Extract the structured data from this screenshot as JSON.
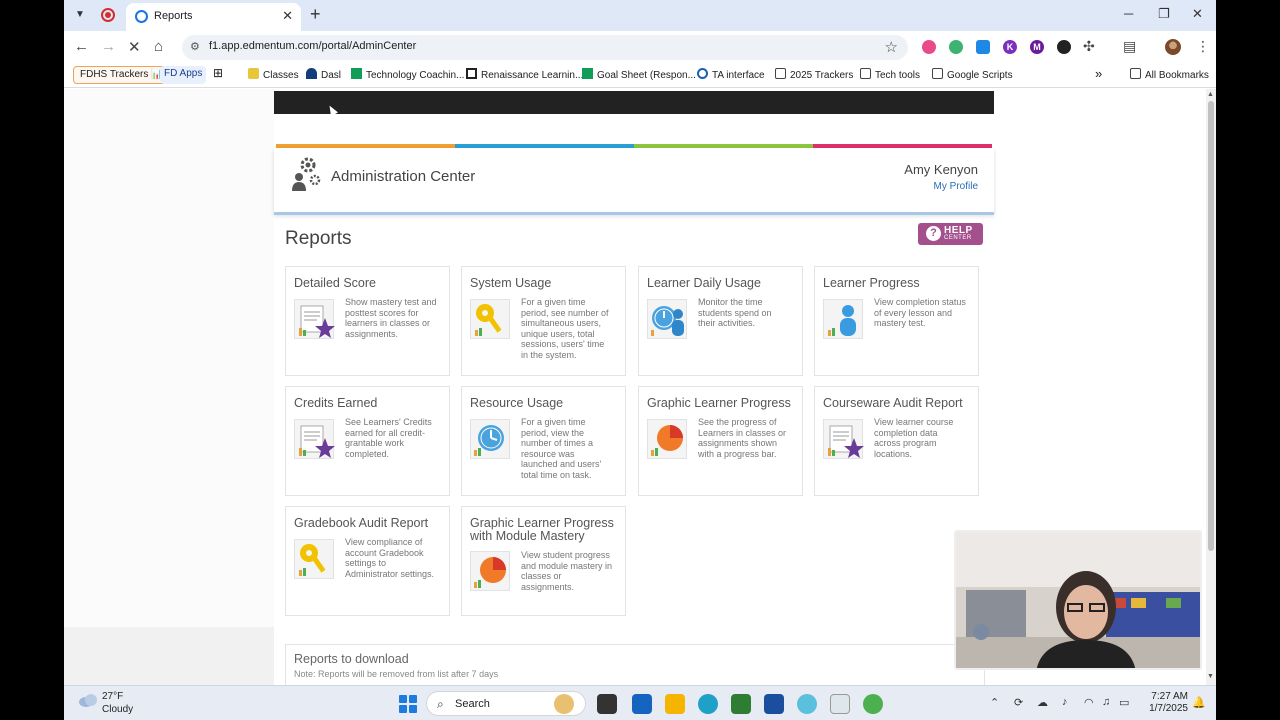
{
  "browser": {
    "tab_title": "Reports",
    "url": "f1.app.edmentum.com/portal/AdminCenter",
    "bookmarks": [
      {
        "label": "FDHS Trackers 📊"
      },
      {
        "label": "FD Apps"
      },
      {
        "label": "Classes"
      },
      {
        "label": "Dasl"
      },
      {
        "label": "Technology Coachin..."
      },
      {
        "label": "Renaissance Learnin..."
      },
      {
        "label": "Goal Sheet (Respon..."
      },
      {
        "label": "TA interface"
      },
      {
        "label": "2025 Trackers"
      },
      {
        "label": "Tech tools"
      },
      {
        "label": "Google Scripts"
      }
    ],
    "all_bookmarks": "All Bookmarks",
    "more_bookmarks": "»"
  },
  "header": {
    "title": "Administration Center",
    "user_name": "Amy Kenyon",
    "profile_link": "My Profile"
  },
  "page": {
    "title": "Reports",
    "help_line1": "HELP",
    "help_line2": "CENTER"
  },
  "reports": [
    {
      "title": "Detailed Score",
      "desc": "Show mastery test and posttest scores for learners in classes or assignments.",
      "icon": "report-star-icon"
    },
    {
      "title": "System Usage",
      "desc": "For a given time period, see number of simultaneous users, unique users, total sessions, users' time in the system.",
      "icon": "key-icon"
    },
    {
      "title": "Learner Daily Usage",
      "desc": "Monitor the time students spend on their activities.",
      "icon": "clock-learner-icon"
    },
    {
      "title": "Learner Progress",
      "desc": "View completion status of every lesson and mastery test.",
      "icon": "learner-icon"
    },
    {
      "title": "Credits Earned",
      "desc": "See Learners' Credits earned for all credit-grantable work completed.",
      "icon": "report-star-icon"
    },
    {
      "title": "Resource Usage",
      "desc": "For a given time period, view the number of times a resource was launched and users' total time on task.",
      "icon": "clock-icon"
    },
    {
      "title": "Graphic Learner Progress",
      "desc": "See the progress of Learners in classes or assignments shown with a progress bar.",
      "icon": "pie-chart-icon"
    },
    {
      "title": "Courseware Audit Report",
      "desc": "View learner course completion data across program locations.",
      "icon": "report-star-icon"
    },
    {
      "title": "Gradebook Audit Report",
      "desc": "View compliance of account Gradebook settings to Administrator settings.",
      "icon": "key-icon"
    },
    {
      "title": "Graphic Learner Progress with Module Mastery",
      "desc": "View student progress and module mastery in classes or assignments.",
      "icon": "pie-chart-icon"
    }
  ],
  "downloads": {
    "title": "Reports to download",
    "note": "Note: Reports will be removed from list after 7 days"
  },
  "taskbar": {
    "temperature": "27°F",
    "condition": "Cloudy",
    "search_label": "Search",
    "time": "7:27 AM",
    "date": "1/7/2025"
  },
  "colors": {
    "rainbow": [
      "#f0a030",
      "#2a9fd6",
      "#8dc63f",
      "#e0306c"
    ],
    "help": "#a4508c",
    "link": "#2a6db4"
  }
}
